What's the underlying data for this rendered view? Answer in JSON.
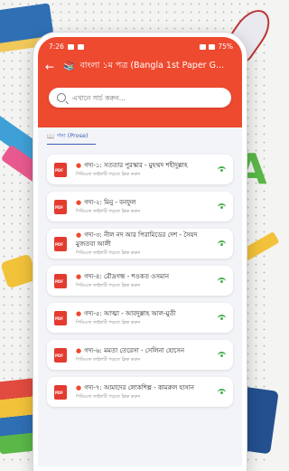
{
  "status_bar": {
    "time": "7:26",
    "battery": "75%"
  },
  "app_bar": {
    "title": "বাংলা ১ম পত্র (Bangla 1st Paper G..."
  },
  "search": {
    "placeholder": "এখানে সার্চ করুন..."
  },
  "section": {
    "label": "গদ্য (Prose)"
  },
  "items": [
    {
      "title": "গদ্য-১: সততার পুরস্কার - মুহম্মদ শহীদুল্লাহ",
      "subtitle": "পিডিএফ ফাইলটি পড়তে ক্লিক করুন"
    },
    {
      "title": "গদ্য-২: মিনু - বনফুল",
      "subtitle": "পিডিএফ ফাইলটি পড়তে ক্লিক করুন"
    },
    {
      "title": "গদ্য-৩: নীল নদ আর পিরামিডের দেশ - সৈয়দ মুজতবা আলী",
      "subtitle": "পিডিএফ ফাইলটি পড়তে ক্লিক করুন"
    },
    {
      "title": "গদ্য-৪: রৌদ্রগন্ধ - শওকত ওসমান",
      "subtitle": "পিডিএফ ফাইলটি পড়তে ক্লিক করুন"
    },
    {
      "title": "গদ্য-৫: আত্মা - আবদুল্লাহ আল-মুতী",
      "subtitle": "পিডিএফ ফাইলটি পড়তে ক্লিক করুন"
    },
    {
      "title": "গদ্য-৬: মমতা তেরেসা - সেলিনা হোসেন",
      "subtitle": "পিডিএফ ফাইলটি পড়তে ক্লিক করুন"
    },
    {
      "title": "গদ্য-৭: আমাদের লোকশিল্প - কামরুল হাসান",
      "subtitle": "পিডিএফ ফাইলটি পড়তে ক্লিক করুন"
    }
  ],
  "colors": {
    "primary": "#ee4a2f",
    "section": "#3b5fb5",
    "pdf": "#e43b30",
    "indicator": "#4caf50"
  }
}
